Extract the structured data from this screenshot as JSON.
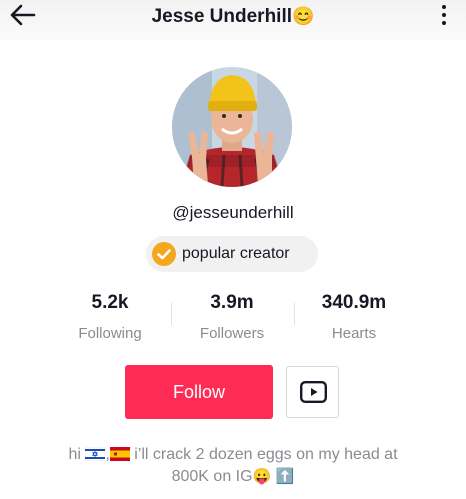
{
  "header": {
    "title": "Jesse Underhill",
    "title_emoji": "😊",
    "back_icon": "back-arrow-icon",
    "more_icon": "more-vertical-icon"
  },
  "profile": {
    "username": "@jesseunderhill",
    "badge_label": "popular creator",
    "badge_icon": "verified-check-icon"
  },
  "stats": [
    {
      "value": "5.2k",
      "label": "Following"
    },
    {
      "value": "3.9m",
      "label": "Followers"
    },
    {
      "value": "340.9m",
      "label": "Hearts"
    }
  ],
  "actions": {
    "follow_label": "Follow",
    "youtube_icon": "youtube-icon"
  },
  "bio": {
    "prefix": "hi",
    "flag_1": "israel-flag-icon",
    "separator": ",",
    "flag_2": "spain-flag-icon",
    "line1_text": "i’ll crack 2 dozen eggs on my head at",
    "line2_text": "800K on IG",
    "emoji_face": "😛",
    "emoji_arrow": "⬆️"
  },
  "colors": {
    "accent": "#fe2c55",
    "badge_check": "#f4a71c",
    "text_primary": "#161823",
    "text_secondary": "#8a8b91"
  }
}
